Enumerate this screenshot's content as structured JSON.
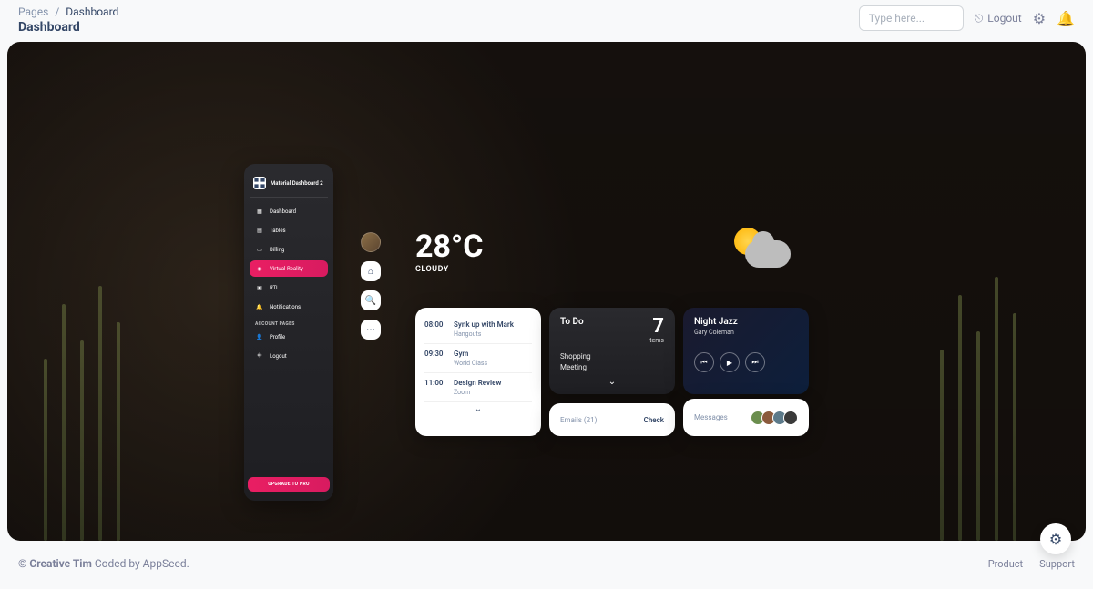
{
  "breadcrumb": {
    "root": "Pages",
    "current": "Dashboard"
  },
  "page_title": "Dashboard",
  "search": {
    "placeholder": "Type here..."
  },
  "topbar": {
    "logout": "Logout"
  },
  "sidenav": {
    "brand": "Material Dashboard 2",
    "section_label": "ACCOUNT PAGES",
    "items": [
      {
        "label": "Dashboard"
      },
      {
        "label": "Tables"
      },
      {
        "label": "Billing"
      },
      {
        "label": "Virtual Reality"
      },
      {
        "label": "RTL"
      },
      {
        "label": "Notifications"
      }
    ],
    "account_items": [
      {
        "label": "Profile"
      },
      {
        "label": "Logout"
      }
    ],
    "upgrade": "UPGRADE TO PRO"
  },
  "weather": {
    "temp": "28°C",
    "desc": "CLOUDY"
  },
  "schedule": [
    {
      "time": "08:00",
      "title": "Synk up with Mark",
      "sub": "Hangouts"
    },
    {
      "time": "09:30",
      "title": "Gym",
      "sub": "World Class"
    },
    {
      "time": "11:00",
      "title": "Design Review",
      "sub": "Zoom"
    }
  ],
  "todo": {
    "title": "To Do",
    "count": "7",
    "items_label": "items",
    "items": [
      "Shopping",
      "Meeting"
    ]
  },
  "music": {
    "title": "Night Jazz",
    "artist": "Gary Coleman"
  },
  "emails": {
    "label": "Emails (21)",
    "action": "Check"
  },
  "messages": {
    "label": "Messages"
  },
  "footer": {
    "copyright_prefix": "© ",
    "brand": "Creative Tim",
    "suffix": " Coded by AppSeed.",
    "links": [
      "Product",
      "Support"
    ]
  }
}
